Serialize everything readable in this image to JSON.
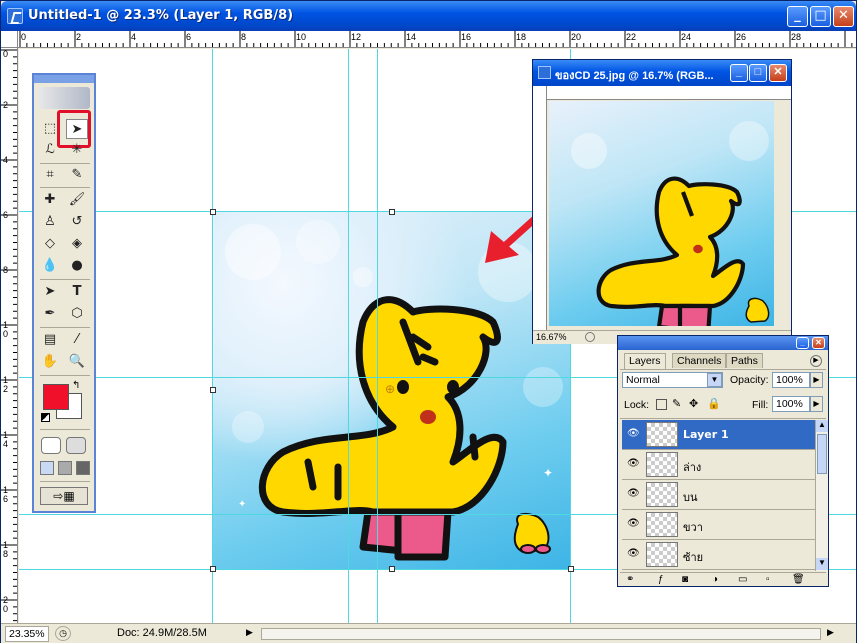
{
  "window": {
    "title": "Untitled-1 @ 23.3% (Layer 1, RGB/8)",
    "minimize": "_",
    "maximize": "□",
    "close": "✕"
  },
  "ruler_top": [
    "0",
    "2",
    "4",
    "6",
    "8",
    "10",
    "12",
    "14",
    "16",
    "18",
    "20",
    "22",
    "24",
    "26",
    "28"
  ],
  "ruler_left": [
    "0",
    "2",
    "4",
    "6",
    "8",
    "10",
    "12",
    "14",
    "16",
    "18",
    "20"
  ],
  "status": {
    "zoom": "23.35%",
    "doc": "Doc: 24.9M/28.5M"
  },
  "toolbox": {
    "tools": [
      "marquee",
      "move",
      "lasso",
      "magic-wand",
      "crop",
      "slice",
      "healing",
      "brush",
      "stamp",
      "history-brush",
      "eraser",
      "bucket",
      "blur",
      "dodge",
      "path-select",
      "type",
      "pen",
      "shape",
      "notes",
      "eyedropper",
      "hand",
      "zoom"
    ],
    "foreground_color": "#f0102a",
    "background_color": "#ffffff"
  },
  "secondary_window": {
    "title": "ของCD 25.jpg @ 16.7% (RGB...",
    "zoom": "16.67%"
  },
  "layers_panel": {
    "tabs": [
      "Layers",
      "Channels",
      "Paths"
    ],
    "blend_mode": "Normal",
    "opacity_label": "Opacity:",
    "opacity_value": "100%",
    "lock_label": "Lock:",
    "fill_label": "Fill:",
    "fill_value": "100%",
    "layers": [
      {
        "name": "Layer 1",
        "selected": true
      },
      {
        "name": "ล่าง",
        "selected": false
      },
      {
        "name": "บน",
        "selected": false
      },
      {
        "name": "ขวา",
        "selected": false
      },
      {
        "name": "ซ้าย",
        "selected": false
      }
    ]
  },
  "colors": {
    "guide": "#4fd8e0",
    "highlight_box": "#e0102a",
    "arrow": "#e8202e",
    "selected_layer": "#316ac5"
  }
}
